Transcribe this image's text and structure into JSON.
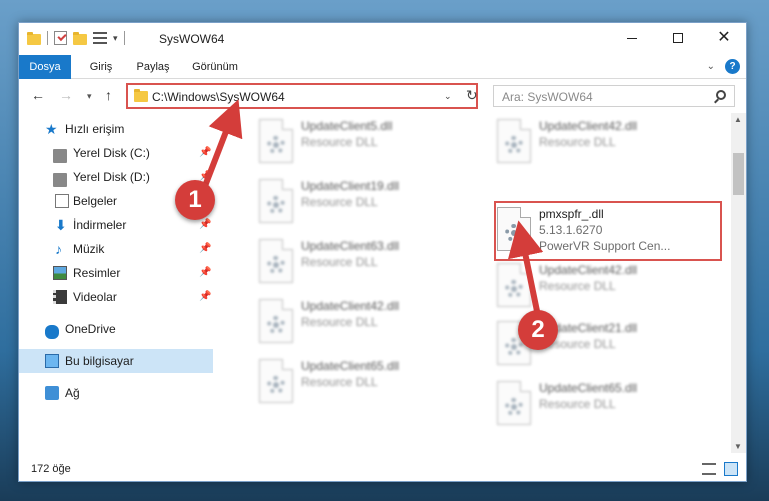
{
  "window": {
    "title": "SysWOW64",
    "quick_access_drop": "▾"
  },
  "ribbon": {
    "tabs": [
      "Dosya",
      "Giriş",
      "Paylaş",
      "Görünüm"
    ],
    "expand": "⌄",
    "help": "?"
  },
  "navigation": {
    "back": "←",
    "forward": "→",
    "recent": "▾",
    "up": "↑",
    "address": "C:\\Windows\\SysWOW64",
    "address_drop": "⌄",
    "refresh": "↻",
    "search_placeholder": "Ara: SysWOW64"
  },
  "sidebar": {
    "items": [
      {
        "label": "Hızlı erişim",
        "icon": "star-icon",
        "pinned": false
      },
      {
        "label": "Yerel Disk (C:)",
        "icon": "disk-icon",
        "pinned": true
      },
      {
        "label": "Yerel Disk (D:)",
        "icon": "disk-icon",
        "pinned": true
      },
      {
        "label": "Belgeler",
        "icon": "document-icon",
        "pinned": true
      },
      {
        "label": "İndirmeler",
        "icon": "download-icon",
        "pinned": true
      },
      {
        "label": "Müzik",
        "icon": "music-icon",
        "pinned": true
      },
      {
        "label": "Resimler",
        "icon": "pictures-icon",
        "pinned": true
      },
      {
        "label": "Videolar",
        "icon": "videos-icon",
        "pinned": true
      },
      {
        "label": "OneDrive",
        "icon": "onedrive-icon",
        "pinned": false
      },
      {
        "label": "Bu bilgisayar",
        "icon": "this-pc-icon",
        "pinned": false,
        "selected": true
      },
      {
        "label": "Ağ",
        "icon": "network-icon",
        "pinned": false
      }
    ],
    "pin_glyph": "📌"
  },
  "files": {
    "left": [
      {
        "name": "UpdateClient5.dll",
        "desc": "Resource DLL"
      },
      {
        "name": "UpdateClient19.dll",
        "desc": "Resource DLL"
      },
      {
        "name": "UpdateClient63.dll",
        "desc": "Resource DLL"
      },
      {
        "name": "UpdateClient42.dll",
        "desc": "Resource DLL"
      },
      {
        "name": "UpdateClient65.dll",
        "desc": "Resource DLL"
      }
    ],
    "right": [
      {
        "name": "UpdateClient42.dll",
        "desc": "Resource DLL"
      },
      {
        "name": "pmxspfr_.dll",
        "desc": "5.13.1.6270",
        "vendor": "PowerVR Support Cen...",
        "highlight": true
      },
      {
        "name": "UpdateClient42.dll",
        "desc": "Resource DLL"
      },
      {
        "name": "UpdateClient21.dll",
        "desc": "Resource DLL"
      },
      {
        "name": "UpdateClient65.dll",
        "desc": "Resource DLL"
      }
    ]
  },
  "status": {
    "count": "172 öğe"
  },
  "annotations": {
    "step1": "1",
    "step2": "2",
    "accent_color": "#d43d3a"
  },
  "colors": {
    "ribbon_file_tab": "#1979ca",
    "selection": "#cce4f7"
  }
}
